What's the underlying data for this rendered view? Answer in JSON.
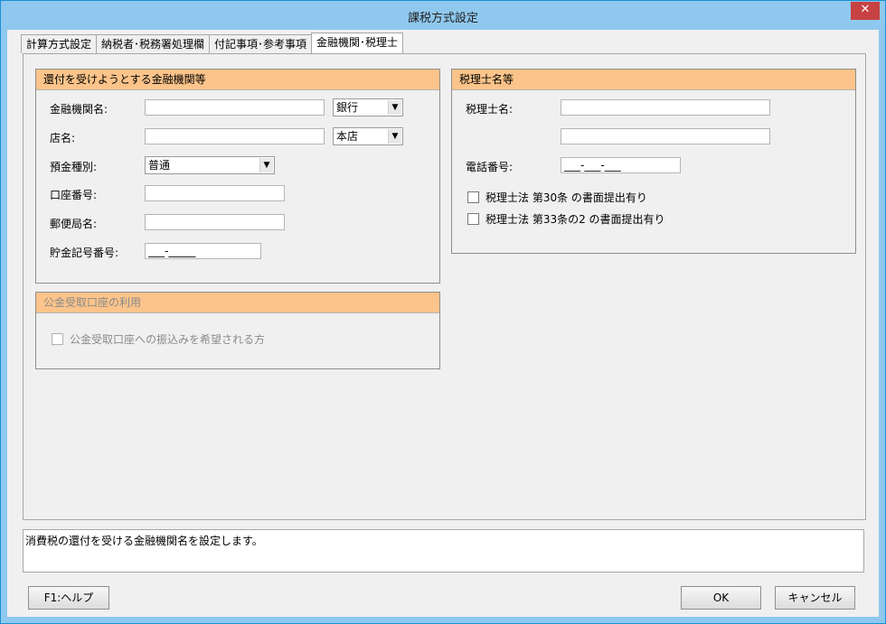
{
  "window": {
    "title": "課税方式設定",
    "close_glyph": "✕"
  },
  "tabs": [
    {
      "label": "計算方式設定"
    },
    {
      "label": "納税者･税務署処理欄"
    },
    {
      "label": "付記事項･参考事項"
    },
    {
      "label": "金融機関･税理士"
    }
  ],
  "refund_group": {
    "title": "還付を受けようとする金融機関等",
    "bank_name_label": "金融機関名:",
    "bank_name_value": "",
    "bank_type_value": "銀行",
    "branch_label": "店名:",
    "branch_value": "",
    "branch_type_value": "本店",
    "deposit_type_label": "預金種別:",
    "deposit_type_value": "普通",
    "account_no_label": "口座番号:",
    "account_no_value": "",
    "post_office_label": "郵便局名:",
    "post_office_value": "",
    "savings_no_label": "貯金記号番号:",
    "savings_no_value": "___-_____"
  },
  "public_fund_group": {
    "title": "公金受取口座の利用",
    "checkbox_label": "公金受取口座への振込みを希望される方"
  },
  "tax_accountant_group": {
    "title": "税理士名等",
    "name_label": "税理士名:",
    "name_value1": "",
    "name_value2": "",
    "phone_label": "電話番号:",
    "phone_value": "___-___-___",
    "check30_label": "税理士法 第30条 の書面提出有り",
    "check33_label": "税理士法 第33条の2 の書面提出有り"
  },
  "status_text": "消費税の還付を受ける金融機関名を設定します。",
  "buttons": {
    "help": "F1:ヘルプ",
    "ok": "OK",
    "cancel": "キャンセル"
  }
}
